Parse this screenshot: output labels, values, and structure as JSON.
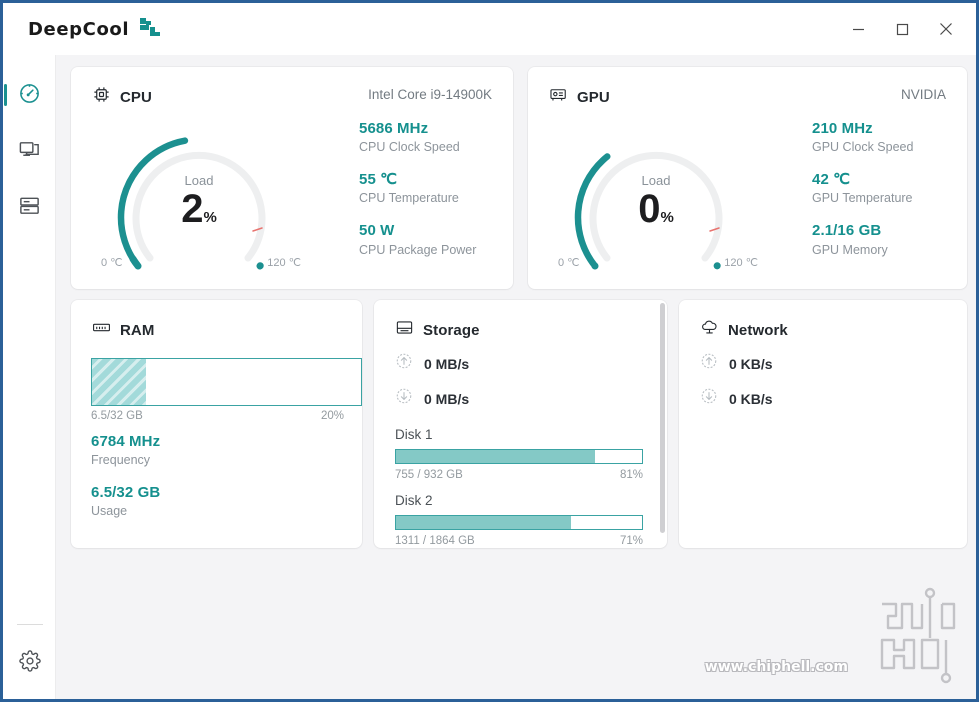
{
  "window": {
    "brand": "DeepCool",
    "brand_icon": "deepcool-logo-icon",
    "minimize_label": "−",
    "maximize_label": "□",
    "close_label": "✕",
    "accent_color": "#15908e",
    "border_color": "#2b6098"
  },
  "sidebar": {
    "items": [
      {
        "name": "dashboard",
        "icon": "gauge-icon",
        "active": true
      },
      {
        "name": "monitor",
        "icon": "monitor-icon",
        "active": false
      },
      {
        "name": "devices",
        "icon": "server-icon",
        "active": false
      }
    ],
    "settings": {
      "name": "settings",
      "icon": "gear-icon"
    }
  },
  "cpu": {
    "title": "CPU",
    "icon": "cpu-chip-icon",
    "model": "Intel Core i9-14900K",
    "gauge": {
      "label": "Load",
      "value": "2",
      "unit": "%",
      "min": "0 ℃",
      "max": "120 ℃",
      "load_percent": 2,
      "temp_percent": 46
    },
    "stats": [
      {
        "value": "5686 MHz",
        "label": "CPU Clock Speed"
      },
      {
        "value": "55 ℃",
        "label": "CPU Temperature"
      },
      {
        "value": "50 W",
        "label": "CPU Package Power"
      }
    ]
  },
  "gpu": {
    "title": "GPU",
    "icon": "gpu-card-icon",
    "model": "NVIDIA",
    "gauge": {
      "label": "Load",
      "value": "0",
      "unit": "%",
      "min": "0 ℃",
      "max": "120 ℃",
      "load_percent": 0,
      "temp_percent": 35
    },
    "stats": [
      {
        "value": "210 MHz",
        "label": "GPU Clock Speed"
      },
      {
        "value": "42 ℃",
        "label": "GPU Temperature"
      },
      {
        "value": "2.1/16 GB",
        "label": "GPU Memory"
      }
    ]
  },
  "ram": {
    "title": "RAM",
    "icon": "ram-stick-icon",
    "bar": {
      "used_label": "6.5/32 GB",
      "percent_label": "20%",
      "percent": 20
    },
    "stats": [
      {
        "value": "6784 MHz",
        "label": "Frequency"
      },
      {
        "value": "6.5/32 GB",
        "label": "Usage"
      }
    ]
  },
  "storage": {
    "title": "Storage",
    "icon": "hard-drive-icon",
    "io": [
      {
        "icon": "arrow-up-circle-icon",
        "text": "0 MB/s"
      },
      {
        "icon": "arrow-down-circle-icon",
        "text": "0 MB/s"
      }
    ],
    "disks": [
      {
        "name": "Disk 1",
        "capacity": "755 / 932 GB",
        "percent_label": "81%",
        "percent": 81
      },
      {
        "name": "Disk 2",
        "capacity": "1311 / 1864 GB",
        "percent_label": "71%",
        "percent": 71
      }
    ]
  },
  "network": {
    "title": "Network",
    "icon": "network-cloud-icon",
    "io": [
      {
        "icon": "arrow-up-circle-icon",
        "text": "0 KB/s"
      },
      {
        "icon": "arrow-down-circle-icon",
        "text": "0 KB/s"
      }
    ]
  },
  "watermark": {
    "text": "www.chiphell.com",
    "logo": "chiphell-logo-icon"
  }
}
